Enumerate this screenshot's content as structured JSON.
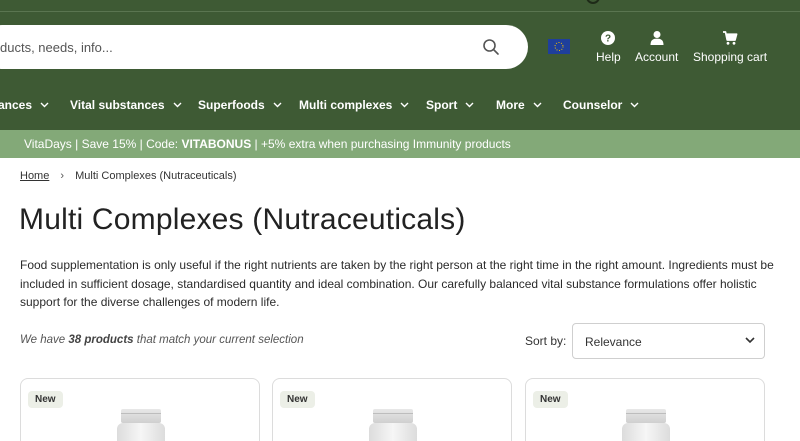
{
  "header": {
    "search_placeholder": "ducts, needs, info...",
    "actions": [
      {
        "label": "Help",
        "icon": "help-circle-icon"
      },
      {
        "label": "Account",
        "icon": "user-icon"
      },
      {
        "label": "Shopping cart",
        "icon": "cart-icon"
      }
    ],
    "flag_icon": "eu-flag-icon",
    "colors": {
      "header_bg": "#3e5a34",
      "promo_bg": "#83a978"
    }
  },
  "nav": {
    "items": [
      {
        "label": "ances"
      },
      {
        "label": "Vital substances"
      },
      {
        "label": "Superfoods"
      },
      {
        "label": "Multi complexes"
      },
      {
        "label": "Sport"
      },
      {
        "label": "More"
      },
      {
        "label": "Counselor"
      }
    ]
  },
  "promo": {
    "prefix": "VitaDays | Save 15% | Code: ",
    "code": "VITABONUS",
    "suffix": " | +5% extra when purchasing Immunity products"
  },
  "breadcrumb": {
    "home": "Home",
    "current": "Multi Complexes (Nutraceuticals)"
  },
  "page": {
    "title": "Multi Complexes (Nutraceuticals)",
    "description": "Food supplementation is only useful if the right nutrients are taken by the right person at the right time in the right amount. Ingredients must be included in sufficient dosage, standardised quantity and ideal combination. Our carefully balanced vital substance formulations offer holistic support for the diverse challenges of modern life.",
    "count_prefix": "We have ",
    "count_value": "38 products",
    "count_suffix": " that match your current selection"
  },
  "sort": {
    "label": "Sort by:",
    "selected": "Relevance"
  },
  "products": [
    {
      "badge": "New"
    },
    {
      "badge": "New"
    },
    {
      "badge": "New"
    }
  ]
}
